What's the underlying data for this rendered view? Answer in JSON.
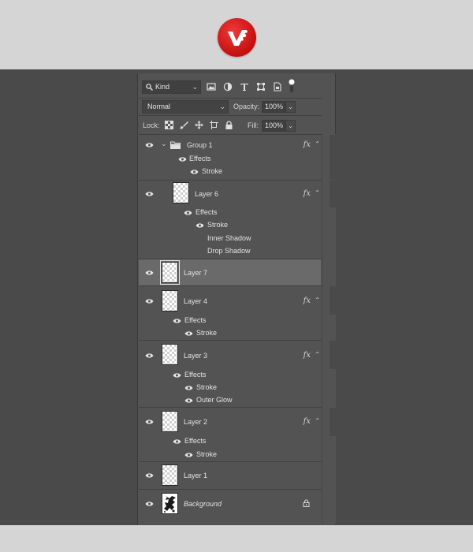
{
  "logo": {
    "icon": "brand-logo-icon",
    "color": "#d21a1a"
  },
  "toolbar": {
    "filter_kind": "Kind",
    "filter_icons": [
      "image-filter-icon",
      "adjustment-filter-icon",
      "type-filter-icon",
      "shape-filter-icon",
      "smart-object-filter-icon"
    ],
    "blend_mode": "Normal",
    "opacity_label": "Opacity:",
    "opacity_value": "100%",
    "lock_label": "Lock:",
    "fill_label": "Fill:",
    "fill_value": "100%"
  },
  "layers": [
    {
      "id": "group1",
      "name": "Group 1",
      "type": "group",
      "fx": "fx",
      "effects_label": "Effects",
      "effects": [
        "Stroke"
      ]
    },
    {
      "id": "layer6",
      "name": "Layer 6",
      "type": "layer",
      "fx": "fx",
      "effects_label": "Effects",
      "effects": [
        "Stroke",
        "Inner Shadow",
        "Drop Shadow"
      ]
    },
    {
      "id": "layer7",
      "name": "Layer 7",
      "type": "layer",
      "selected": true
    },
    {
      "id": "layer4",
      "name": "Layer 4",
      "type": "layer",
      "fx": "fx",
      "effects_label": "Effects",
      "effects": [
        "Stroke"
      ]
    },
    {
      "id": "layer3",
      "name": "Layer 3",
      "type": "layer",
      "fx": "fx",
      "effects_label": "Effects",
      "effects": [
        "Stroke",
        "Outer Glow"
      ]
    },
    {
      "id": "layer2",
      "name": "Layer 2",
      "type": "layer",
      "fx": "fx",
      "effects_label": "Effects",
      "effects": [
        "Stroke"
      ]
    },
    {
      "id": "layer1",
      "name": "Layer 1",
      "type": "layer"
    },
    {
      "id": "background",
      "name": "Background",
      "type": "background",
      "locked": true
    }
  ]
}
